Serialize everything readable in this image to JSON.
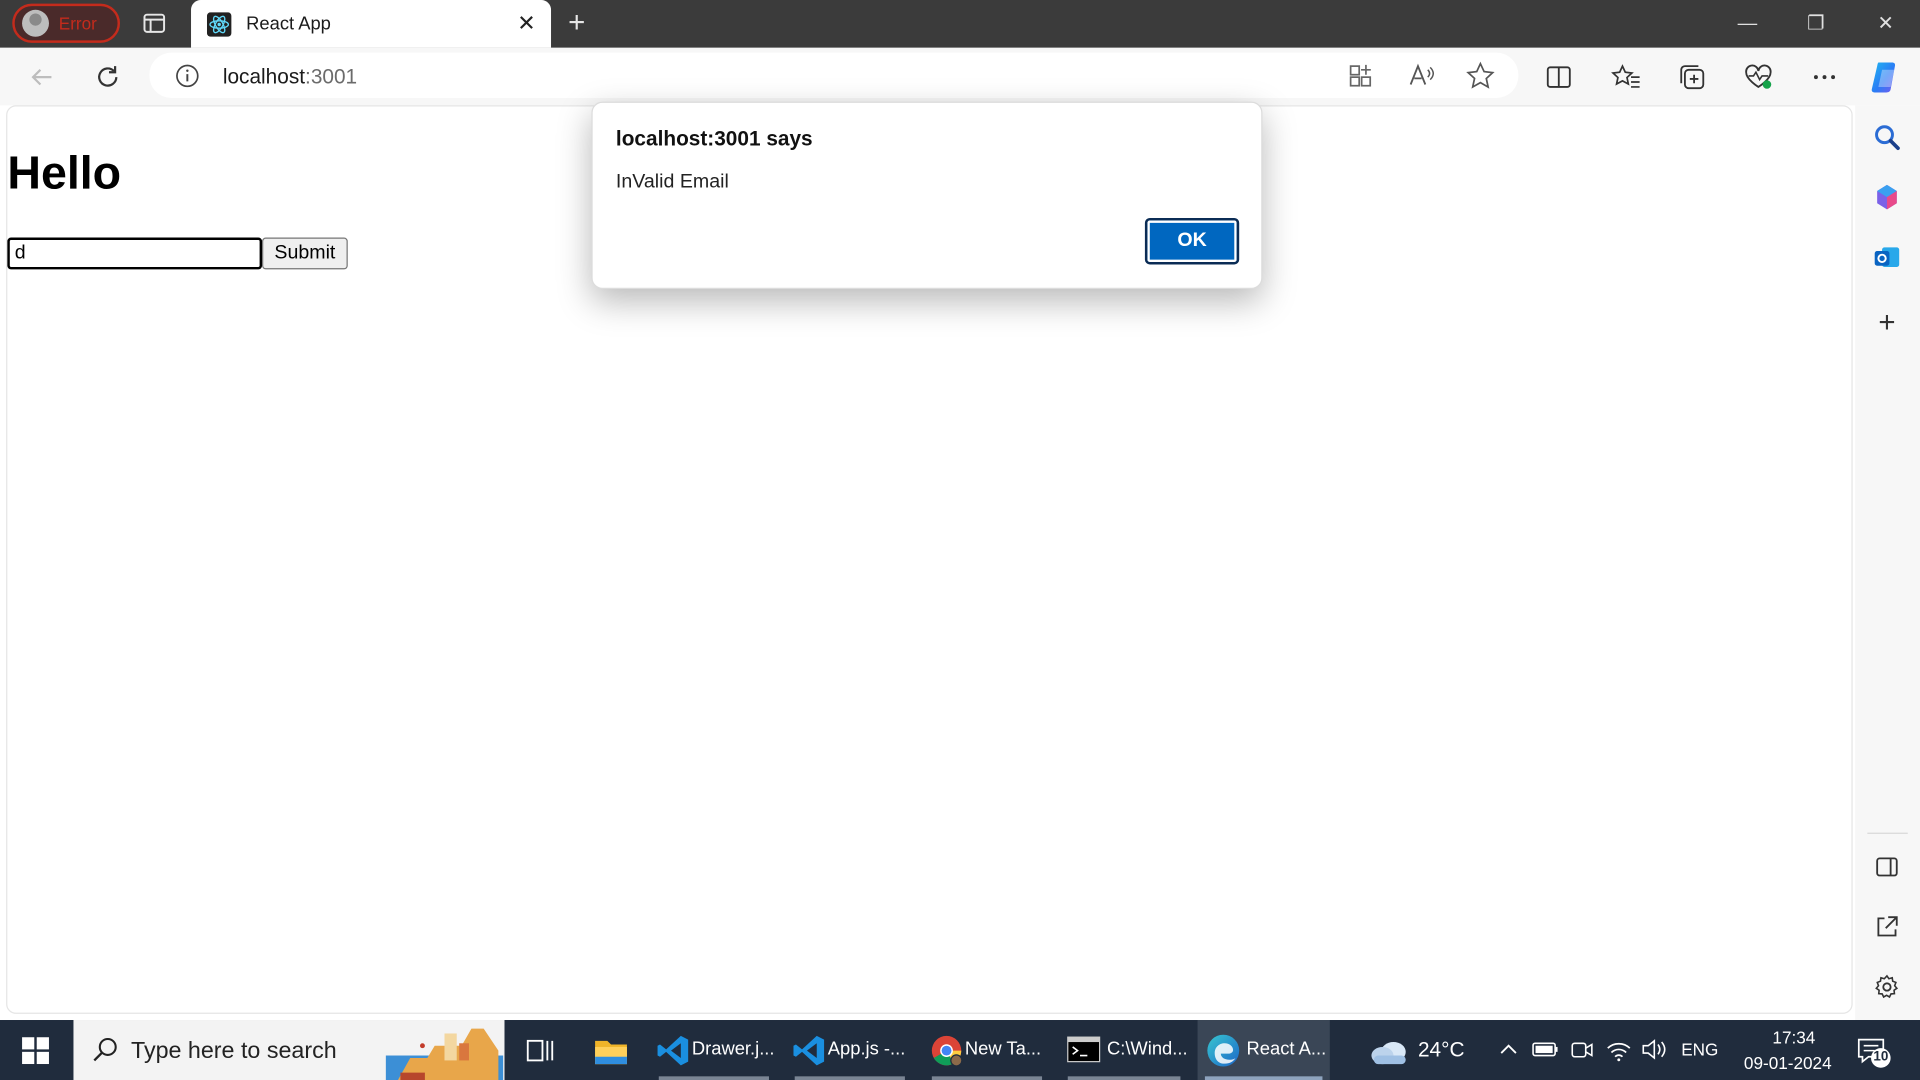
{
  "browser": {
    "profile_label": "Error",
    "tab_title": "React App",
    "address": {
      "host": "localhost",
      "port": ":3001"
    }
  },
  "page": {
    "heading": "Hello",
    "input_value": "d",
    "submit_label": "Submit"
  },
  "dialog": {
    "title": "localhost:3001 says",
    "message": "InValid Email",
    "ok_label": "OK"
  },
  "taskbar": {
    "search_placeholder": "Type here to search",
    "apps": [
      {
        "label": "Drawer.j...",
        "icon": "vscode-icon"
      },
      {
        "label": "App.js -...",
        "icon": "vscode-icon"
      },
      {
        "label": "New Ta...",
        "icon": "chrome-icon"
      },
      {
        "label": "C:\\Wind...",
        "icon": "terminal-icon"
      },
      {
        "label": "React A...",
        "icon": "edge-icon"
      }
    ],
    "weather": "24°C",
    "language": "ENG",
    "time": "17:34",
    "date": "09-01-2024",
    "notifications": "10"
  },
  "colors": {
    "accent": "#0067c0",
    "titlebar": "#3b3b3b",
    "taskbar": "#202c3d"
  }
}
